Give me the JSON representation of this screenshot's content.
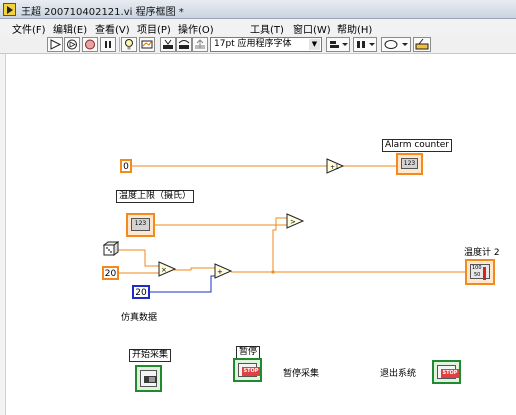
{
  "window": {
    "title": "王超 200710402121.vi 程序框图 *"
  },
  "menu": [
    "文件(F)",
    "编辑(E)",
    "查看(V)",
    "项目(P)",
    "操作(O)",
    "工具(T)",
    "窗口(W)",
    "帮助(H)"
  ],
  "toolbar": {
    "font_select": "17pt 应用程序字体",
    "icons": [
      "run-arrow-icon",
      "run-continuous-icon",
      "abort-icon",
      "pause-icon",
      "highlight-execution-icon",
      "retain-wire-values-icon",
      "step-into-icon",
      "step-over-icon",
      "step-out-icon",
      "align-icon",
      "distribute-icon",
      "reorder-icon",
      "cleanup-icon"
    ]
  },
  "diagram": {
    "constants": {
      "zero": "0",
      "twenty_a": "20",
      "twenty_b": "20"
    },
    "labels": {
      "alarm_counter": "Alarm counter",
      "temp_upper_limit": "温度上限（摄氏）",
      "thermometer": "温度计 2",
      "sim_data": "仿真数据",
      "start_collect": "开始采集",
      "pause": "暂停",
      "pause_collect": "暂停采集",
      "exit_system": "退出系统"
    },
    "indicators": {
      "alarm_counter_type": "123",
      "temp_limit_type": "123",
      "thermometer_scale_top": "100",
      "thermometer_scale_mid": "50",
      "stop_text": "STOP",
      "bool_tf": "TF"
    },
    "operators": {
      "multiply": "×",
      "add": "+",
      "greater": ">",
      "increment": "+1"
    }
  },
  "colors": {
    "numeric_wire": "#f28a1e",
    "integer_wire": "#1f2cc8",
    "boolean_terminal": "#1f8a2f"
  }
}
